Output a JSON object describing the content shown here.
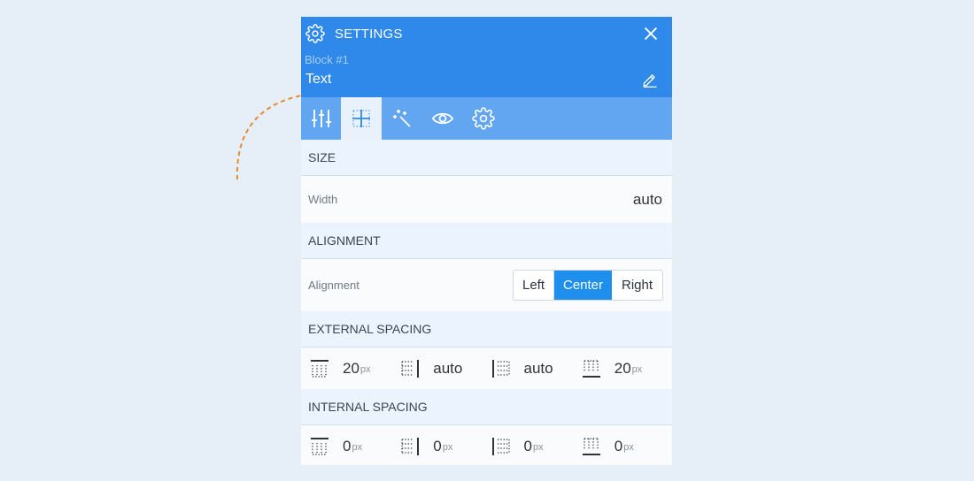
{
  "header": {
    "title": "SETTINGS",
    "block_number": "Block #1",
    "block_name": "Text"
  },
  "tabs": [
    {
      "icon": "sliders-icon",
      "active": false
    },
    {
      "icon": "layout-grid-icon",
      "active": true
    },
    {
      "icon": "magic-wand-icon",
      "active": false
    },
    {
      "icon": "eye-icon",
      "active": false
    },
    {
      "icon": "gear-icon",
      "active": false
    }
  ],
  "size": {
    "heading": "SIZE",
    "width_label": "Width",
    "width_value": "auto"
  },
  "alignment": {
    "heading": "ALIGNMENT",
    "label": "Alignment",
    "options": [
      "Left",
      "Center",
      "Right"
    ],
    "selected": "Center"
  },
  "external_spacing": {
    "heading": "EXTERNAL SPACING",
    "top": "20",
    "top_unit": "px",
    "right": "auto",
    "right_unit": "",
    "left": "auto",
    "left_unit": "",
    "bottom": "20",
    "bottom_unit": "px"
  },
  "internal_spacing": {
    "heading": "INTERNAL SPACING",
    "top": "0",
    "top_unit": "px",
    "right": "0",
    "right_unit": "px",
    "left": "0",
    "left_unit": "px",
    "bottom": "0",
    "bottom_unit": "px"
  },
  "colors": {
    "header_blue": "#2e89ea",
    "tab_bar_blue": "#62a5f1",
    "selected_button": "#1e8fed",
    "arrow_orange": "#e98a2e"
  }
}
